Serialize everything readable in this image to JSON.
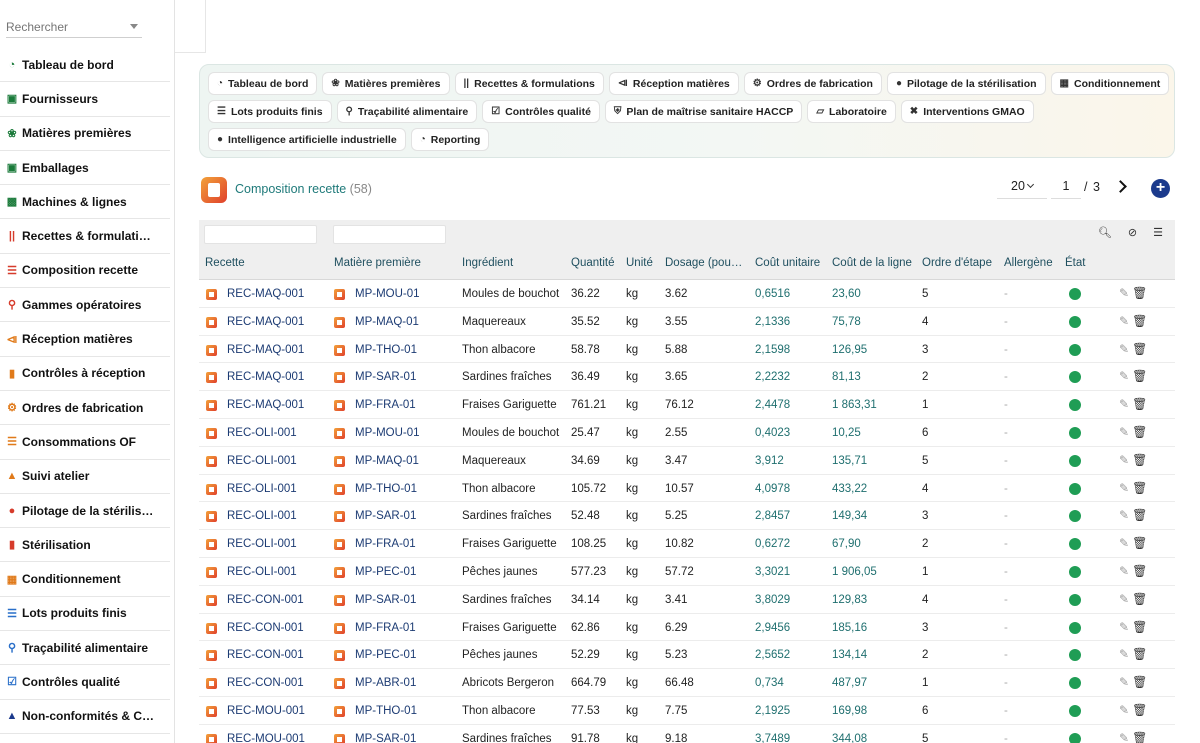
{
  "sidebar": {
    "search_placeholder": "Rechercher",
    "items": [
      {
        "label": "Tableau de bord",
        "icon": "dashboard-icon",
        "color": "#1a7a3a"
      },
      {
        "label": "Fournisseurs",
        "icon": "truck-icon",
        "color": "#1a7a3a"
      },
      {
        "label": "Matières premières",
        "icon": "leaf-icon",
        "color": "#1a7a3a"
      },
      {
        "label": "Emballages",
        "icon": "box-icon",
        "color": "#1a7a3a"
      },
      {
        "label": "Machines & lignes",
        "icon": "industry-icon",
        "color": "#1a7a3a"
      },
      {
        "label": "Recettes & formulati…",
        "icon": "utensils-icon",
        "color": "#d63b2b"
      },
      {
        "label": "Composition recette",
        "icon": "list-icon",
        "color": "#d63b2b"
      },
      {
        "label": "Gammes opératoires",
        "icon": "sitemap-icon",
        "color": "#d63b2b"
      },
      {
        "label": "Réception matières",
        "icon": "dolly-icon",
        "color": "#e07a1a"
      },
      {
        "label": "Contrôles à réception",
        "icon": "clipboard-icon",
        "color": "#e07a1a"
      },
      {
        "label": "Ordres de fabrication",
        "icon": "cogs-icon",
        "color": "#e07a1a"
      },
      {
        "label": "Consommations OF",
        "icon": "list-icon",
        "color": "#e07a1a"
      },
      {
        "label": "Suivi atelier",
        "icon": "helmet-icon",
        "color": "#e07a1a"
      },
      {
        "label": "Pilotage de la stérilis…",
        "icon": "fire-icon",
        "color": "#d63b2b"
      },
      {
        "label": "Stérilisation",
        "icon": "thermometer-icon",
        "color": "#d63b2b"
      },
      {
        "label": "Conditionnement",
        "icon": "boxes-icon",
        "color": "#e07a1a"
      },
      {
        "label": "Lots produits finis",
        "icon": "barcode-icon",
        "color": "#2a6fc9"
      },
      {
        "label": "Traçabilité alimentaire",
        "icon": "tree-icon",
        "color": "#2a6fc9"
      },
      {
        "label": "Contrôles qualité",
        "icon": "clipboard-check-icon",
        "color": "#2a6fc9"
      },
      {
        "label": "Non-conformités & C…",
        "icon": "warning-icon",
        "color": "#1b3a8c"
      }
    ]
  },
  "modules": [
    [
      {
        "label": "Tableau de bord",
        "icon": "dashboard-icon"
      },
      {
        "label": "Matières premières",
        "icon": "leaf-icon"
      },
      {
        "label": "Recettes & formulations",
        "icon": "utensils-icon"
      },
      {
        "label": "Réception matières",
        "icon": "dolly-icon"
      },
      {
        "label": "Ordres de fabrication",
        "icon": "cogs-icon"
      },
      {
        "label": "Pilotage de la stérilisation",
        "icon": "fire-icon"
      },
      {
        "label": "Conditionnement",
        "icon": "boxes-icon"
      }
    ],
    [
      {
        "label": "Lots produits finis",
        "icon": "barcode-icon"
      },
      {
        "label": "Traçabilité alimentaire",
        "icon": "tree-icon"
      },
      {
        "label": "Contrôles qualité",
        "icon": "clipboard-check-icon"
      },
      {
        "label": "Plan de maîtrise sanitaire HACCP",
        "icon": "shield-icon"
      },
      {
        "label": "Laboratoire",
        "icon": "flask-icon"
      },
      {
        "label": "Interventions GMAO",
        "icon": "tools-icon"
      }
    ],
    [
      {
        "label": "Intelligence artificielle industrielle",
        "icon": "lightbulb-icon"
      },
      {
        "label": "Reporting",
        "icon": "chart-pie-icon"
      }
    ]
  ],
  "header": {
    "title": "Composition recette",
    "count": "(58)",
    "per_page": "20",
    "page": "1",
    "slash": "/",
    "total_pages": "3"
  },
  "table": {
    "columns": [
      "Recette",
      "Matière première",
      "Ingrédient",
      "Quantité",
      "Unité",
      "Dosage (pou…",
      "Coût unitaire",
      "Coût de la ligne",
      "Ordre d'étape",
      "Allergène",
      "État"
    ],
    "rows": [
      [
        "REC-MAQ-001",
        "MP-MOU-01",
        "Moules de bouchot",
        "36.22",
        "kg",
        "3.62",
        "0,6516",
        "23,60",
        "5",
        "-"
      ],
      [
        "REC-MAQ-001",
        "MP-MAQ-01",
        "Maquereaux",
        "35.52",
        "kg",
        "3.55",
        "2,1336",
        "75,78",
        "4",
        "-"
      ],
      [
        "REC-MAQ-001",
        "MP-THO-01",
        "Thon albacore",
        "58.78",
        "kg",
        "5.88",
        "2,1598",
        "126,95",
        "3",
        "-"
      ],
      [
        "REC-MAQ-001",
        "MP-SAR-01",
        "Sardines fraîches",
        "36.49",
        "kg",
        "3.65",
        "2,2232",
        "81,13",
        "2",
        "-"
      ],
      [
        "REC-MAQ-001",
        "MP-FRA-01",
        "Fraises Gariguette",
        "761.21",
        "kg",
        "76.12",
        "2,4478",
        "1 863,31",
        "1",
        "-"
      ],
      [
        "REC-OLI-001",
        "MP-MOU-01",
        "Moules de bouchot",
        "25.47",
        "kg",
        "2.55",
        "0,4023",
        "10,25",
        "6",
        "-"
      ],
      [
        "REC-OLI-001",
        "MP-MAQ-01",
        "Maquereaux",
        "34.69",
        "kg",
        "3.47",
        "3,912",
        "135,71",
        "5",
        "-"
      ],
      [
        "REC-OLI-001",
        "MP-THO-01",
        "Thon albacore",
        "105.72",
        "kg",
        "10.57",
        "4,0978",
        "433,22",
        "4",
        "-"
      ],
      [
        "REC-OLI-001",
        "MP-SAR-01",
        "Sardines fraîches",
        "52.48",
        "kg",
        "5.25",
        "2,8457",
        "149,34",
        "3",
        "-"
      ],
      [
        "REC-OLI-001",
        "MP-FRA-01",
        "Fraises Gariguette",
        "108.25",
        "kg",
        "10.82",
        "0,6272",
        "67,90",
        "2",
        "-"
      ],
      [
        "REC-OLI-001",
        "MP-PEC-01",
        "Pêches jaunes",
        "577.23",
        "kg",
        "57.72",
        "3,3021",
        "1 906,05",
        "1",
        "-"
      ],
      [
        "REC-CON-001",
        "MP-SAR-01",
        "Sardines fraîches",
        "34.14",
        "kg",
        "3.41",
        "3,8029",
        "129,83",
        "4",
        "-"
      ],
      [
        "REC-CON-001",
        "MP-FRA-01",
        "Fraises Gariguette",
        "62.86",
        "kg",
        "6.29",
        "2,9456",
        "185,16",
        "3",
        "-"
      ],
      [
        "REC-CON-001",
        "MP-PEC-01",
        "Pêches jaunes",
        "52.29",
        "kg",
        "5.23",
        "2,5652",
        "134,14",
        "2",
        "-"
      ],
      [
        "REC-CON-001",
        "MP-ABR-01",
        "Abricots Bergeron",
        "664.79",
        "kg",
        "66.48",
        "0,734",
        "487,97",
        "1",
        "-"
      ],
      [
        "REC-MOU-001",
        "MP-THO-01",
        "Thon albacore",
        "77.53",
        "kg",
        "7.75",
        "2,1925",
        "169,98",
        "6",
        "-"
      ],
      [
        "REC-MOU-001",
        "MP-SAR-01",
        "Sardines fraîches",
        "91.78",
        "kg",
        "9.18",
        "3,7489",
        "344,08",
        "5",
        "-"
      ]
    ]
  },
  "colors": {
    "accent": "#1f7a7a",
    "link": "#1c3b73",
    "status_ok": "#1f9d55",
    "brand": "#1b3a8c"
  }
}
